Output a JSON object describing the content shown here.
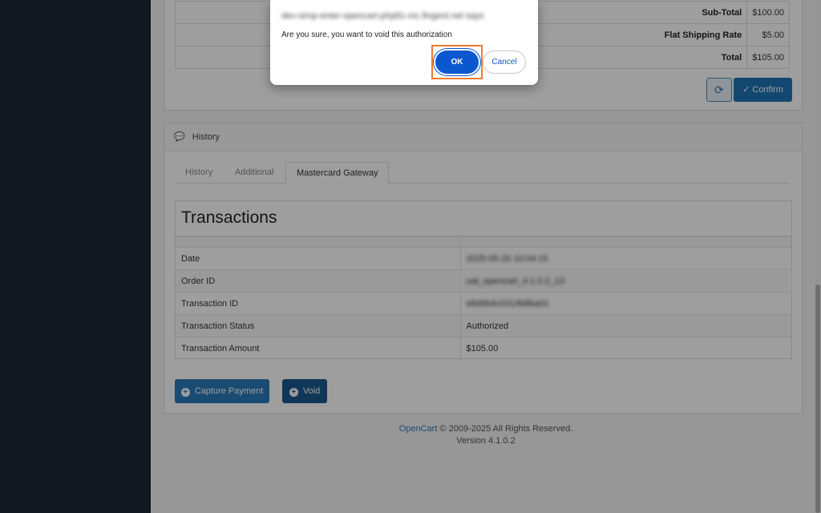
{
  "totals": [
    {
      "label": "Sub-Total",
      "value": "$100.00"
    },
    {
      "label": "Flat Shipping Rate",
      "value": "$5.00"
    },
    {
      "label": "Total",
      "value": "$105.00"
    }
  ],
  "actions": {
    "refresh_icon": "refresh-icon",
    "confirm_label": "Confirm"
  },
  "history": {
    "heading": "History",
    "tabs": [
      "History",
      "Additional",
      "Mastercard Gateway"
    ],
    "transactions_title": "Transactions",
    "rows": [
      {
        "label": "Date",
        "value": "2025-05-20 10:04:15"
      },
      {
        "label": "Order ID",
        "value": "uat_opencart_4.1.0.2_13"
      },
      {
        "label": "Transaction ID",
        "value": "e8d9b4c0314b8ba01"
      },
      {
        "label": "Transaction Status",
        "value": "Authorized"
      },
      {
        "label": "Transaction Amount",
        "value": "$105.00"
      }
    ],
    "capture_label": "Capture Payment",
    "void_label": "Void"
  },
  "footer": {
    "brand": "OpenCart",
    "copyright": " © 2009-2025 All Rights Reserved.",
    "version": "Version 4.1.0.2"
  },
  "dialog": {
    "origin": "dev-simp-enter-opencart-php81-mc.fingent.net says",
    "message": "Are you sure, you want to void this authorization",
    "ok_label": "OK",
    "cancel_label": "Cancel"
  }
}
